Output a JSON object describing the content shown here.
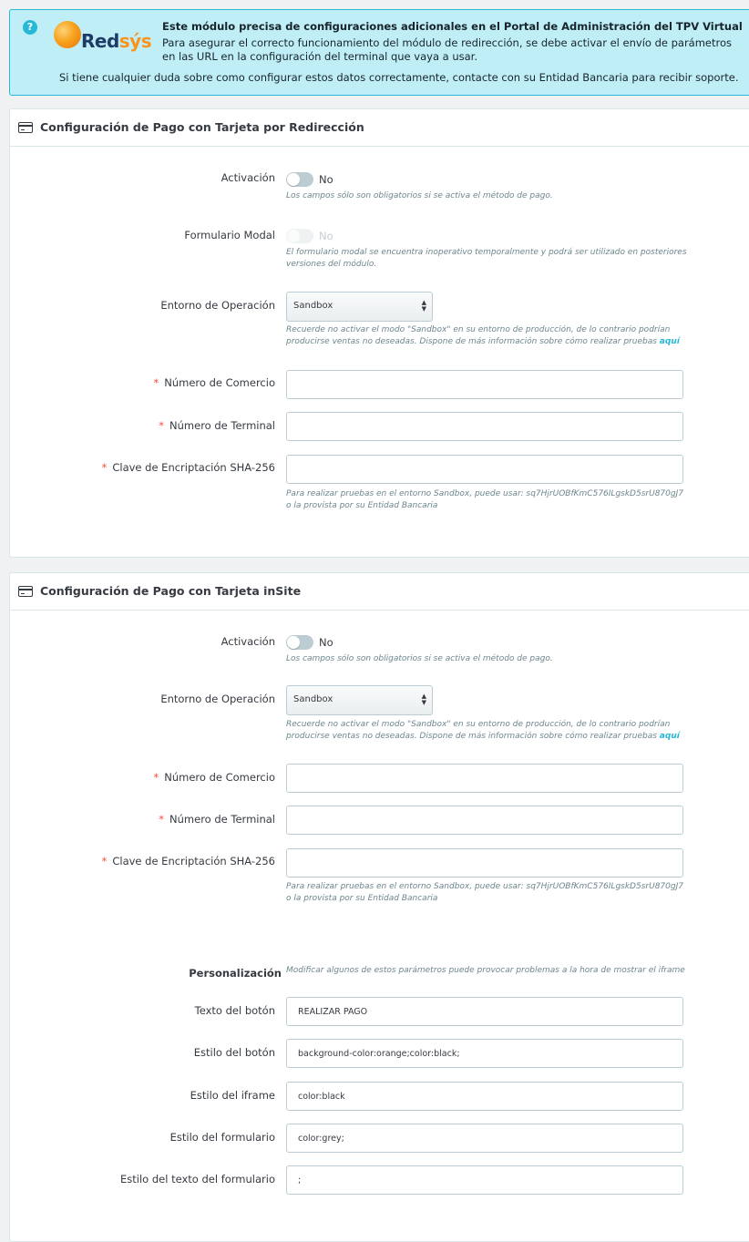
{
  "alert": {
    "title": "Este módulo precisa de configuraciones adicionales en el Portal de Administración del TPV Virtual",
    "text": "Para asegurar el correcto funcionamiento del módulo de redirección, se debe activar el envío de parámetros en las URL en la configuración del terminal que vaya a usar.",
    "support": "Si tiene cualquier duda sobre como configurar estos datos correctamente, contacte con su Entidad Bancaria para recibir soporte.",
    "logo_red": "Red",
    "logo_sys": "sýs",
    "help_icon": "?"
  },
  "redirect": {
    "title": "Configuración de Pago con Tarjeta por Redirección",
    "activation_label": "Activación",
    "activation_value": "No",
    "activation_help": "Los campos sólo son obligatorios si se activa el método de pago.",
    "modal_label": "Formulario Modal",
    "modal_value": "No",
    "modal_help": "El formulario modal se encuentra inoperativo temporalmente y podrá ser utilizado en posteriores versiones del módulo.",
    "env_label": "Entorno de Operación",
    "env_value": "Sandbox",
    "env_help": "Recuerde no activar el modo \"Sandbox\" en su entorno de producción, de lo contrario podrían producirse ventas no deseadas. Dispone de más información sobre cómo realizar pruebas",
    "env_help_link": "aquí",
    "merchant_label": "Número de Comercio",
    "merchant_value": "",
    "terminal_label": "Número de Terminal",
    "terminal_value": "",
    "key_label": "Clave de Encriptación SHA-256",
    "key_value": "",
    "key_help": "Para realizar pruebas en el entorno Sandbox, puede usar: sq7HjrUOBfKmC576ILgskD5srU870gJ7 o la provista por su Entidad Bancaria",
    "required_mark": "*"
  },
  "insite": {
    "title": "Configuración de Pago con Tarjeta inSite",
    "activation_label": "Activación",
    "activation_value": "No",
    "activation_help": "Los campos sólo son obligatorios si se activa el método de pago.",
    "env_label": "Entorno de Operación",
    "env_value": "Sandbox",
    "env_help": "Recuerde no activar el modo \"Sandbox\" en su entorno de producción, de lo contrario podrían producirse ventas no deseadas. Dispone de más información sobre cómo realizar pruebas",
    "env_help_link": "aquí",
    "merchant_label": "Número de Comercio",
    "merchant_value": "",
    "terminal_label": "Número de Terminal",
    "terminal_value": "",
    "key_label": "Clave de Encriptación SHA-256",
    "key_value": "",
    "key_help": "Para realizar pruebas en el entorno Sandbox, puede usar: sq7HjrUOBfKmC576ILgskD5srU870gJ7 o la provista por su Entidad Bancaria",
    "required_mark": "*",
    "custom_label": "Personalización",
    "custom_help": "Modificar algunos de estos parámetros puede provocar problemas a la hora de mostrar el iframe",
    "button_text_label": "Texto del botón",
    "button_text_value": "REALIZAR PAGO",
    "button_style_label": "Estilo del botón",
    "button_style_value": "background-color:orange;color:black;",
    "iframe_style_label": "Estilo del iframe",
    "iframe_style_value": "color:black",
    "form_style_label": "Estilo del formulario",
    "form_style_value": "color:grey;",
    "form_text_style_label": "Estilo del texto del formulario",
    "form_text_style_value": ";"
  },
  "colors": {
    "accent": "#25b9d7",
    "required": "#f54c3e",
    "alert_bg": "#bfeef7"
  }
}
